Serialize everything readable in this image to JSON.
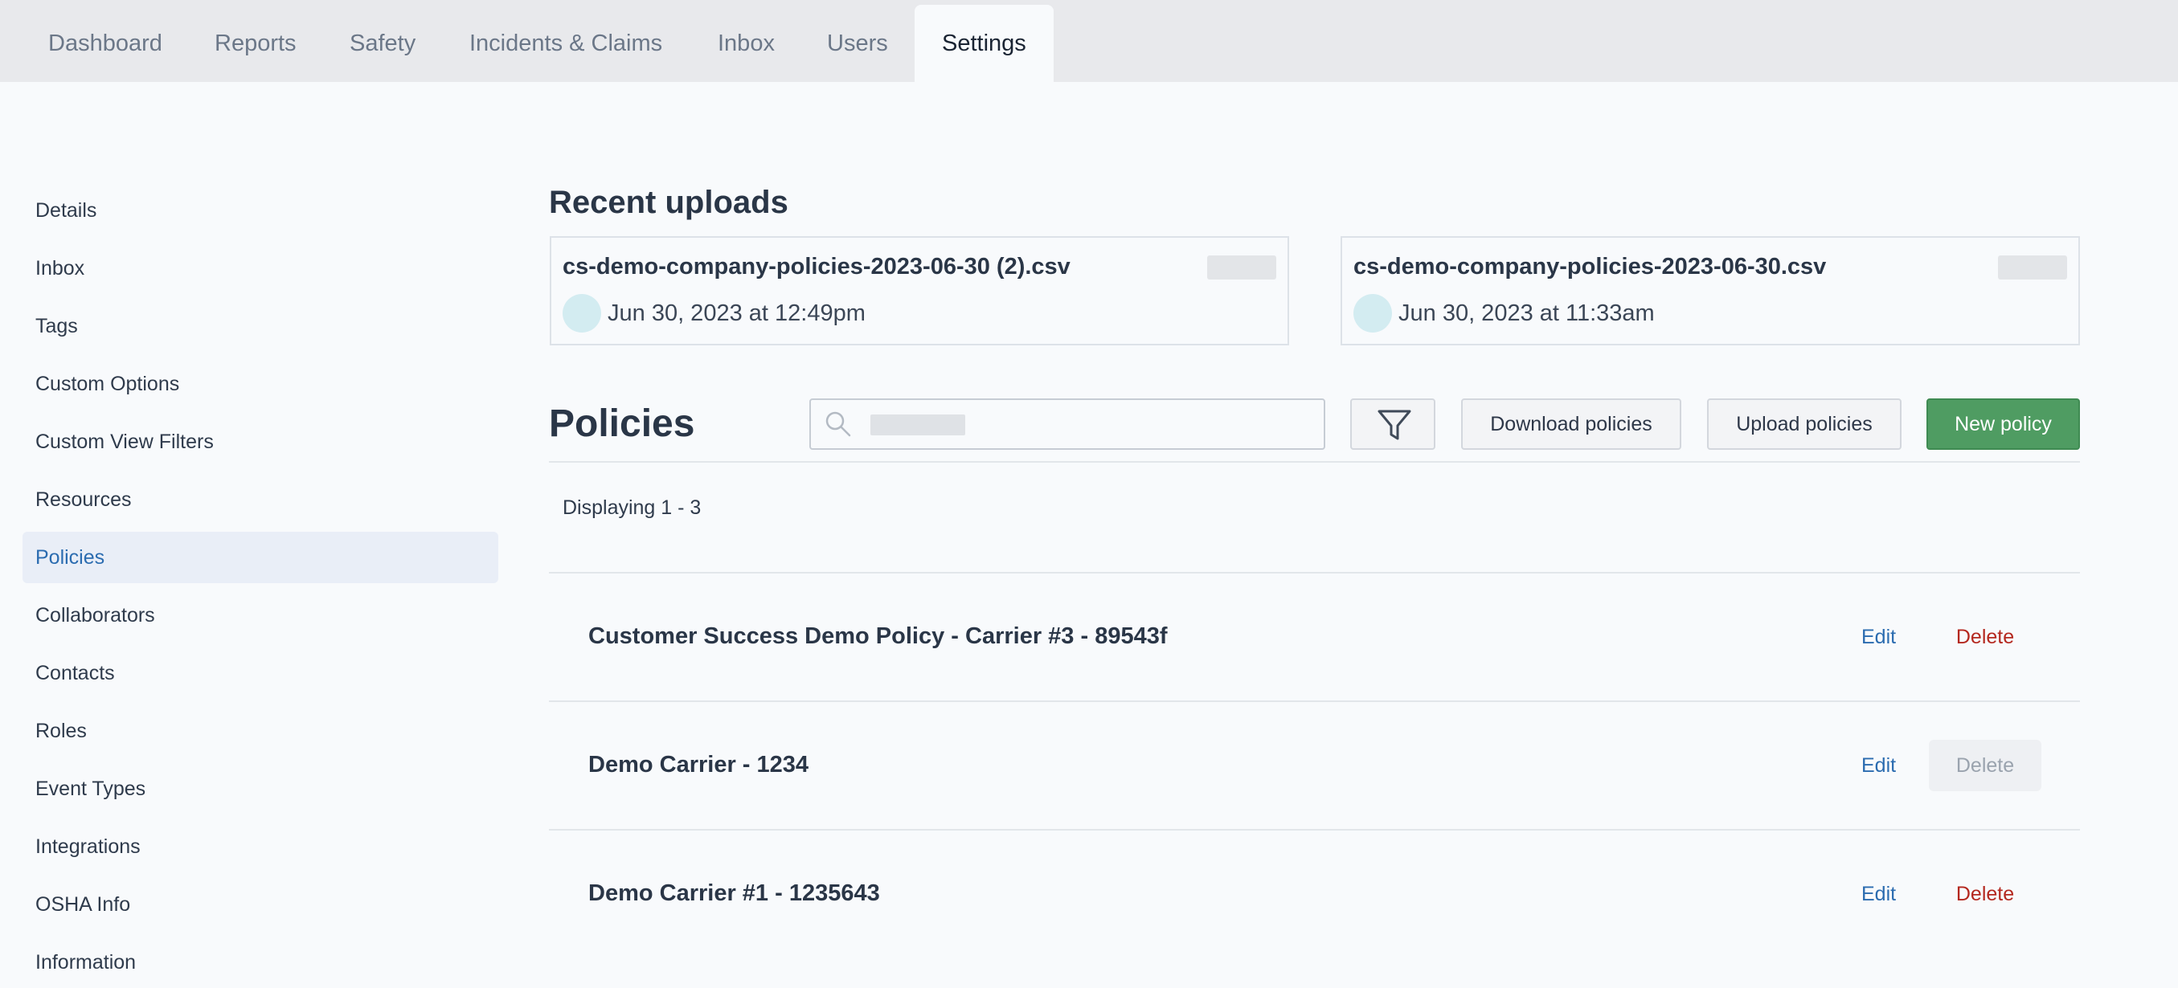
{
  "nav": {
    "tabs": [
      {
        "label": "Dashboard"
      },
      {
        "label": "Reports"
      },
      {
        "label": "Safety"
      },
      {
        "label": "Incidents & Claims"
      },
      {
        "label": "Inbox"
      },
      {
        "label": "Users"
      },
      {
        "label": "Settings",
        "active": true
      }
    ]
  },
  "sidebar": {
    "items": [
      {
        "label": "Details"
      },
      {
        "label": "Inbox"
      },
      {
        "label": "Tags"
      },
      {
        "label": "Custom Options"
      },
      {
        "label": "Custom View Filters"
      },
      {
        "label": "Resources"
      },
      {
        "label": "Policies",
        "active": true
      },
      {
        "label": "Collaborators"
      },
      {
        "label": "Contacts"
      },
      {
        "label": "Roles"
      },
      {
        "label": "Event Types"
      },
      {
        "label": "Integrations"
      },
      {
        "label": "OSHA Info"
      },
      {
        "label": "Information"
      }
    ]
  },
  "uploads": {
    "title": "Recent uploads",
    "items": [
      {
        "filename": "cs-demo-company-policies-2023-06-30 (2).csv",
        "date": "Jun 30, 2023 at 12:49pm"
      },
      {
        "filename": "cs-demo-company-policies-2023-06-30.csv",
        "date": "Jun 30, 2023 at 11:33am"
      }
    ]
  },
  "policies": {
    "title": "Policies",
    "search": {
      "placeholder": "",
      "value": ""
    },
    "buttons": {
      "download": "Download policies",
      "upload": "Upload policies",
      "new": "New policy"
    },
    "display_count": "Displaying 1 - 3",
    "rows": [
      {
        "name": "Customer Success Demo Policy - Carrier #3 - 89543f",
        "edit": "Edit",
        "delete": "Delete",
        "delete_disabled": false
      },
      {
        "name": "Demo Carrier - 1234",
        "edit": "Edit",
        "delete": "Delete",
        "delete_disabled": true
      },
      {
        "name": "Demo Carrier #1 - 1235643",
        "edit": "Edit",
        "delete": "Delete",
        "delete_disabled": false
      }
    ]
  },
  "colors": {
    "accent": "#2b6cb0",
    "primary_button": "#4f9c62",
    "danger": "#b4281f",
    "nav_background": "#e8e9ec"
  },
  "icons": [
    "search-icon",
    "filter-icon",
    "avatar"
  ]
}
